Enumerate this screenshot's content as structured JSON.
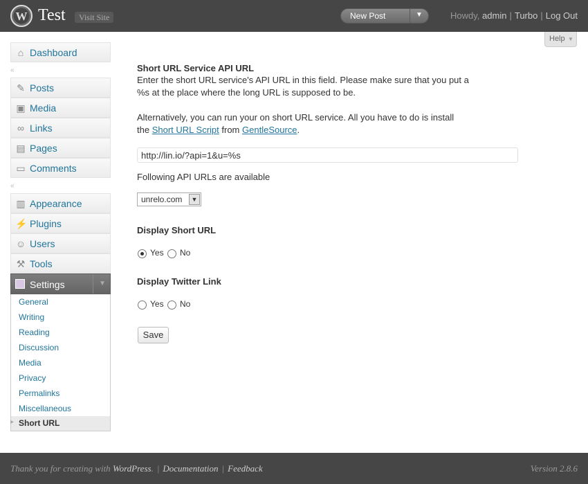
{
  "header": {
    "site_title": "Test",
    "visit_site": "Visit Site",
    "new_post": "New Post",
    "howdy": "Howdy,",
    "user": "admin",
    "turbo": "Turbo",
    "logout": "Log Out"
  },
  "help": {
    "label": "Help"
  },
  "sidebar": {
    "dashboard": "Dashboard",
    "posts": "Posts",
    "media": "Media",
    "links": "Links",
    "pages": "Pages",
    "comments": "Comments",
    "appearance": "Appearance",
    "plugins": "Plugins",
    "users": "Users",
    "tools": "Tools",
    "settings": "Settings",
    "submenu": [
      "General",
      "Writing",
      "Reading",
      "Discussion",
      "Media",
      "Privacy",
      "Permalinks",
      "Miscellaneous",
      "Short URL"
    ]
  },
  "main": {
    "api_heading": "Short URL Service API URL",
    "api_desc_1": "Enter the short URL service's API URL in this field. Please make sure that you put a",
    "api_desc_2": "%s at the place where the long URL is supposed to be.",
    "alt_line_1": "Alternatively, you can run your on short URL service. All you have to do is install",
    "alt_the": "the",
    "alt_link_1": "Short URL Script",
    "alt_from": "from",
    "alt_link_2": "GentleSource",
    "alt_period": ".",
    "api_value": "http://lin.io/?api=1&u=%s",
    "following_label": "Following API URLs are available",
    "select_value": "unrelo.com",
    "display_short_heading": "Display Short URL",
    "display_twitter_heading": "Display Twitter Link",
    "yes": "Yes",
    "no": "No",
    "display_short_selected": "Yes",
    "display_twitter_selected": "",
    "save": "Save"
  },
  "footer": {
    "thanks": "Thank you for creating with",
    "wordpress": "WordPress",
    "documentation": "Documentation",
    "feedback": "Feedback",
    "version": "Version 2.8.6"
  }
}
